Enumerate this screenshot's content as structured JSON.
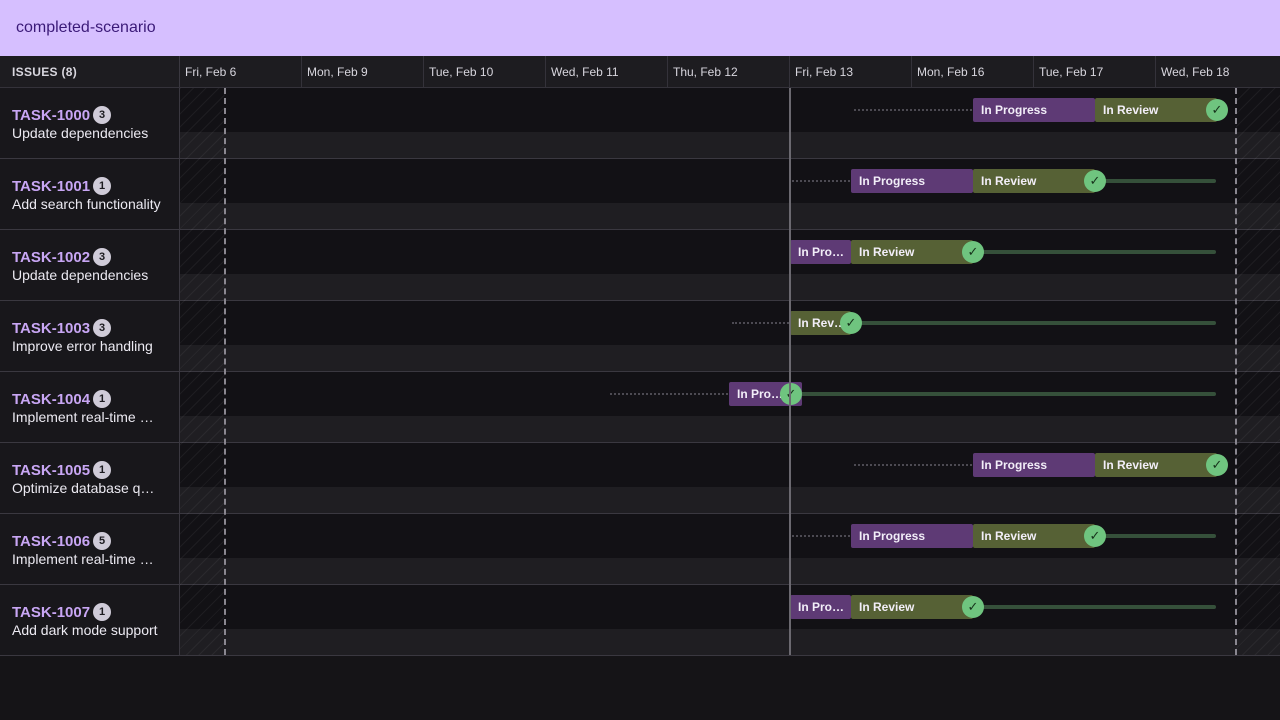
{
  "app": {
    "title": "completed-scenario"
  },
  "header": {
    "issues_label": "ISSUES (8)"
  },
  "timeline": {
    "dates": [
      "Fri, Feb 6",
      "Mon, Feb 9",
      "Tue, Feb 10",
      "Wed, Feb 11",
      "Thu, Feb 12",
      "Fri, Feb 13",
      "Mon, Feb 16",
      "Tue, Feb 17",
      "Wed, Feb 18"
    ]
  },
  "statuses": {
    "in_progress": "In Progress",
    "in_review": "In Review"
  },
  "colors": {
    "accent": "#d6bfff",
    "in_progress": "#5e3a75",
    "in_review": "#566135",
    "done_check": "#6fc47f",
    "issue_key": "#c8a6f4"
  },
  "issues": [
    {
      "key": "TASK-1000",
      "count": "3",
      "summary": "Update dependencies",
      "bars": [
        {
          "status": "In Progress",
          "label": "In Progress"
        },
        {
          "status": "In Review",
          "label": "In Review"
        }
      ]
    },
    {
      "key": "TASK-1001",
      "count": "1",
      "summary": "Add search functionality",
      "bars": [
        {
          "status": "In Progress",
          "label": "In Progress"
        },
        {
          "status": "In Review",
          "label": "In Review"
        }
      ]
    },
    {
      "key": "TASK-1002",
      "count": "3",
      "summary": "Update dependencies",
      "bars": [
        {
          "status": "In Progress",
          "label": "In Pro…"
        },
        {
          "status": "In Review",
          "label": "In Review"
        }
      ]
    },
    {
      "key": "TASK-1003",
      "count": "3",
      "summary": "Improve error handling",
      "bars": [
        {
          "status": "In Review",
          "label": "In Rev…"
        }
      ]
    },
    {
      "key": "TASK-1004",
      "count": "1",
      "summary": "Implement real-time …",
      "bars": [
        {
          "status": "In Progress",
          "label": "In Pro…"
        }
      ]
    },
    {
      "key": "TASK-1005",
      "count": "1",
      "summary": "Optimize database q…",
      "bars": [
        {
          "status": "In Progress",
          "label": "In Progress"
        },
        {
          "status": "In Review",
          "label": "In Review"
        }
      ]
    },
    {
      "key": "TASK-1006",
      "count": "5",
      "summary": "Implement real-time …",
      "bars": [
        {
          "status": "In Progress",
          "label": "In Progress"
        },
        {
          "status": "In Review",
          "label": "In Review"
        }
      ]
    },
    {
      "key": "TASK-1007",
      "count": "1",
      "summary": "Add dark mode support",
      "bars": [
        {
          "status": "In Progress",
          "label": "In Pro…"
        },
        {
          "status": "In Review",
          "label": "In Review"
        }
      ]
    }
  ]
}
